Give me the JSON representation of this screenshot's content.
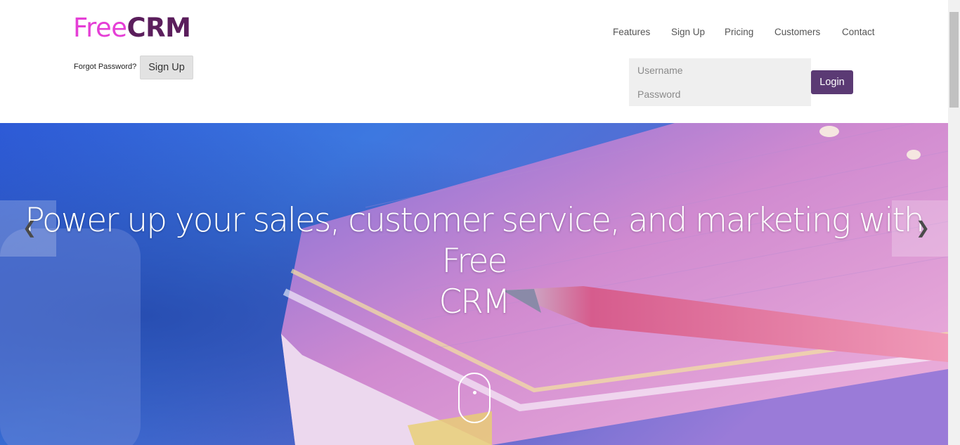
{
  "logo": {
    "part1": "Free",
    "part2": "CRM"
  },
  "nav": {
    "items": [
      {
        "label": "Features"
      },
      {
        "label": "Sign Up"
      },
      {
        "label": "Pricing"
      },
      {
        "label": "Customers"
      },
      {
        "label": "Contact"
      }
    ]
  },
  "auth": {
    "forgot_label": "Forgot Password?",
    "signup_label": "Sign Up",
    "username_placeholder": "Username",
    "password_placeholder": "Password",
    "login_label": "Login"
  },
  "hero": {
    "title_line1": "Power up your sales, customer service, and marketing with Free",
    "title_line2": "CRM",
    "prev_icon": "chevron-left-icon",
    "next_icon": "chevron-right-icon",
    "scroll_icon": "mouse-scroll-icon"
  },
  "colors": {
    "logo_free": "#e53fd6",
    "logo_crm": "#5b1e5c",
    "login_button": "#5b3a74",
    "signup_button": "#e2e2e2",
    "login_box": "#efefef"
  }
}
